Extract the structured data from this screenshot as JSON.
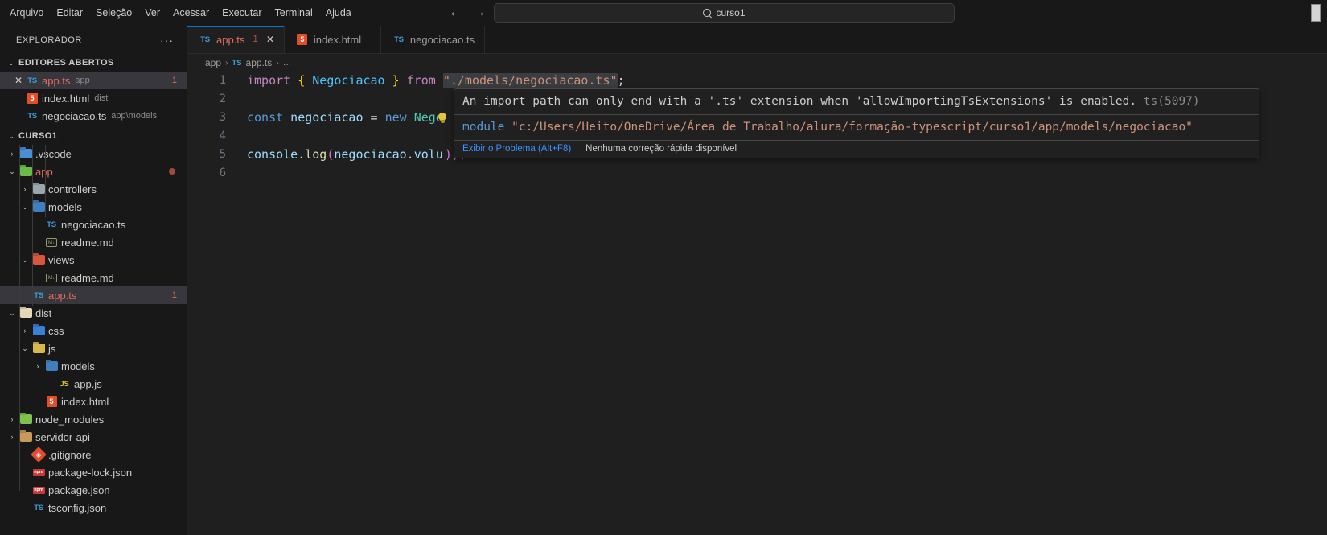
{
  "titlebar": {
    "menus": [
      "Arquivo",
      "Editar",
      "Seleção",
      "Ver",
      "Acessar",
      "Executar",
      "Terminal",
      "Ajuda"
    ],
    "nav_back": "←",
    "nav_forward": "→",
    "command_center_text": "curso1",
    "search_icon": "search-icon"
  },
  "sidebar": {
    "header_title": "EXPLORADOR",
    "header_more": "···",
    "open_editors": {
      "label": "EDITORES ABERTOS",
      "chevron": "⌄",
      "items": [
        {
          "name": "app.ts",
          "sub": "app",
          "icon": "ts",
          "badge": "1",
          "selected": true,
          "close": "✕"
        },
        {
          "name": "index.html",
          "sub": "dist",
          "icon": "html",
          "badge": "",
          "selected": false,
          "close": ""
        },
        {
          "name": "negociacao.ts",
          "sub": "app\\models",
          "icon": "ts",
          "badge": "",
          "selected": false,
          "close": ""
        }
      ]
    },
    "project": {
      "label": "CURSO1",
      "chevron": "⌄",
      "items": [
        {
          "name": ".vscode",
          "icon": "folder-blue",
          "indent": 1,
          "chevron": "›",
          "badge": "",
          "dirty": false,
          "selected": false
        },
        {
          "name": "app",
          "icon": "folder-green",
          "indent": 1,
          "chevron": "⌄",
          "badge": "",
          "dirty": true,
          "selected": false,
          "color": "orange"
        },
        {
          "name": "controllers",
          "icon": "folder-gray",
          "indent": 2,
          "chevron": "›",
          "badge": "",
          "dirty": false,
          "selected": false
        },
        {
          "name": "models",
          "icon": "folder-dkblue",
          "indent": 2,
          "chevron": "⌄",
          "badge": "",
          "dirty": false,
          "selected": false
        },
        {
          "name": "negociacao.ts",
          "icon": "ts",
          "indent": 3,
          "chevron": "",
          "badge": "",
          "dirty": false,
          "selected": false
        },
        {
          "name": "readme.md",
          "icon": "md",
          "indent": 3,
          "chevron": "",
          "badge": "",
          "dirty": false,
          "selected": false
        },
        {
          "name": "views",
          "icon": "folder-red",
          "indent": 2,
          "chevron": "⌄",
          "badge": "",
          "dirty": false,
          "selected": false
        },
        {
          "name": "readme.md",
          "icon": "md",
          "indent": 3,
          "chevron": "",
          "badge": "",
          "dirty": false,
          "selected": false
        },
        {
          "name": "app.ts",
          "icon": "ts",
          "indent": 2,
          "chevron": "",
          "badge": "1",
          "dirty": false,
          "selected": true,
          "color": "orange"
        },
        {
          "name": "dist",
          "icon": "folder-cream",
          "indent": 1,
          "chevron": "⌄",
          "badge": "",
          "dirty": false,
          "selected": false
        },
        {
          "name": "css",
          "icon": "folder-css",
          "indent": 2,
          "chevron": "›",
          "badge": "",
          "dirty": false,
          "selected": false
        },
        {
          "name": "js",
          "icon": "folder-yellow",
          "indent": 2,
          "chevron": "⌄",
          "badge": "",
          "dirty": false,
          "selected": false
        },
        {
          "name": "models",
          "icon": "folder-dkblue",
          "indent": 3,
          "chevron": "›",
          "badge": "",
          "dirty": false,
          "selected": false
        },
        {
          "name": "app.js",
          "icon": "js",
          "indent": 4,
          "chevron": "",
          "badge": "",
          "dirty": false,
          "selected": false
        },
        {
          "name": "index.html",
          "icon": "html",
          "indent": 3,
          "chevron": "",
          "badge": "",
          "dirty": false,
          "selected": false
        },
        {
          "name": "node_modules",
          "icon": "folder-lgreen",
          "indent": 1,
          "chevron": "›",
          "badge": "",
          "dirty": false,
          "selected": false
        },
        {
          "name": "servidor-api",
          "icon": "folder-tan",
          "indent": 1,
          "chevron": "›",
          "badge": "",
          "dirty": false,
          "selected": false
        },
        {
          "name": ".gitignore",
          "icon": "git",
          "indent": 2,
          "chevron": "",
          "badge": "",
          "dirty": false,
          "selected": false
        },
        {
          "name": "package-lock.json",
          "icon": "npm",
          "indent": 2,
          "chevron": "",
          "badge": "",
          "dirty": false,
          "selected": false
        },
        {
          "name": "package.json",
          "icon": "npm",
          "indent": 2,
          "chevron": "",
          "badge": "",
          "dirty": false,
          "selected": false
        },
        {
          "name": "tsconfig.json",
          "icon": "tsconfig",
          "indent": 2,
          "chevron": "",
          "badge": "",
          "dirty": false,
          "selected": false
        }
      ]
    }
  },
  "editor": {
    "tabs": [
      {
        "label": "app.ts",
        "icon": "ts",
        "badge": "1",
        "close": "✕",
        "active": true
      },
      {
        "label": "index.html",
        "icon": "html",
        "badge": "",
        "close": "",
        "active": false
      },
      {
        "label": "negociacao.ts",
        "icon": "ts",
        "badge": "",
        "close": "",
        "active": false
      }
    ],
    "breadcrumb": {
      "part1": "app",
      "sep": "›",
      "ts_icon": "TS",
      "part2": "app.ts",
      "ellipsis": "…"
    },
    "line_numbers": [
      "1",
      "2",
      "3",
      "4",
      "5",
      "6"
    ],
    "code": {
      "l1_import": "import",
      "l1_brace_open": " { ",
      "l1_ident": "Negociacao",
      "l1_brace_close": " } ",
      "l1_from": "from",
      "l1_space": " ",
      "l1_string": "\"./models/negociacao.ts\"",
      "l1_semi": ";",
      "l3_const": "const",
      "l3_name": " negociacao ",
      "l3_eq": "= ",
      "l3_new": "new",
      "l3_cls": " Nego",
      "l5_console": "console",
      "l5_dot": ".",
      "l5_log": "log",
      "l5_paren": "(",
      "l5_arg": "negociacao.volu",
      "l5_tail": "));"
    },
    "bulb_icon": "lightbulb-icon"
  },
  "hover": {
    "message": "An import path can only end with a '.ts' extension when 'allowImportingTsExtensions' is enabled.",
    "code": " ts(5097)",
    "module_keyword": "module",
    "module_path": " \"c:/Users/Heito/OneDrive/Área de Trabalho/alura/formação-typescript/curso1/app/models/negociacao\"",
    "action_link": "Exibir o Problema (Alt+F8)",
    "action_muted": "Nenhuma correção rápida disponível"
  },
  "colors": {
    "accent": "#0078d4",
    "error": "#e51400",
    "ts_orange": "#e06c5d",
    "link": "#3794ff"
  }
}
